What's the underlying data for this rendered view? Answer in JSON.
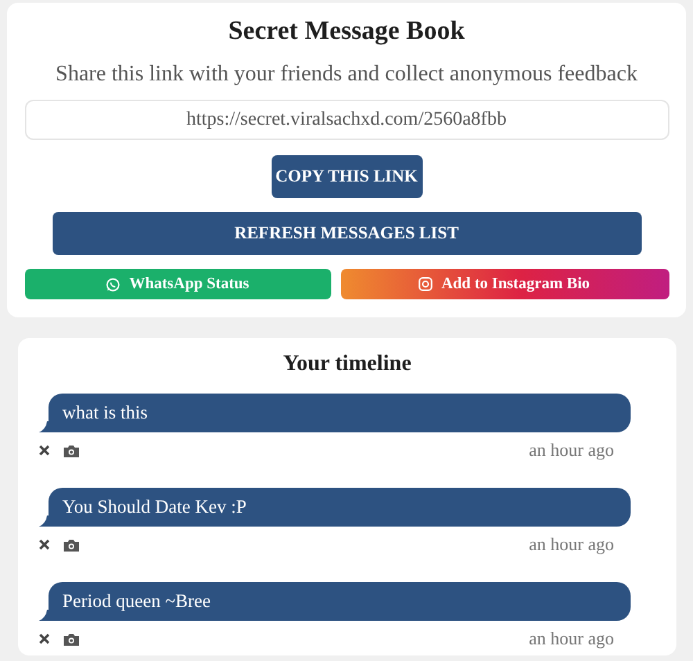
{
  "header": {
    "title": "Secret Message Book",
    "subtitle": "Share this link with your friends and collect anonymous feedback",
    "link": "https://secret.viralsachxd.com/2560a8fbb",
    "copy_button": "COPY THIS LINK",
    "refresh_button": "REFRESH MESSAGES LIST",
    "share_buttons": [
      {
        "kind": "whatsapp",
        "label": "WhatsApp Status"
      },
      {
        "kind": "instagram",
        "label": "Add to Instagram Bio"
      }
    ]
  },
  "timeline": {
    "title": "Your timeline",
    "messages": [
      {
        "text": "what is this",
        "time": "an hour ago"
      },
      {
        "text": "You Should Date Kev :P",
        "time": "an hour ago"
      },
      {
        "text": "Period queen ~Bree",
        "time": "an hour ago"
      }
    ]
  }
}
